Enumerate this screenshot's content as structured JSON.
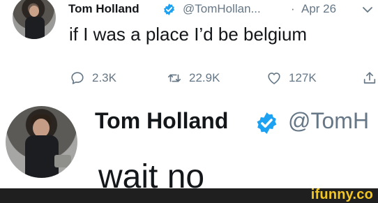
{
  "tweet_top": {
    "author_name": "Tom Holland",
    "handle": "@TomHollan...",
    "separator": "·",
    "date": "Apr 26",
    "text": "if I was a place I’d be belgium",
    "actions": {
      "reply_count": "2.3K",
      "retweet_count": "22.9K",
      "like_count": "127K"
    }
  },
  "tweet_bottom": {
    "author_name": "Tom Holland",
    "handle": "@TomH",
    "text": "wait no"
  },
  "watermark": {
    "text": "ifunny.co"
  },
  "colors": {
    "text": "#14171a",
    "muted": "#657786",
    "verified": "#1da1f2",
    "watermark": "#f3c623",
    "watermark_bar": "#1f1f1f"
  }
}
